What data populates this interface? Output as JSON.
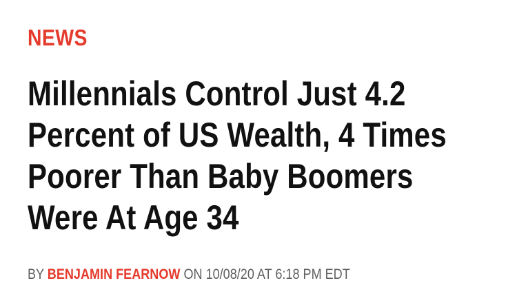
{
  "category": {
    "label": "NEWS",
    "color": "#e53b2c"
  },
  "headline": "Millennials Control Just 4.2 Percent of US Wealth, 4 Times Poorer Than Baby Boomers Were At Age 34",
  "byline": {
    "prefix": "BY",
    "author": "BENJAMIN FEARNOW",
    "on": "ON",
    "date": "10/08/20",
    "at": "AT",
    "time": "6:18 PM EDT"
  }
}
